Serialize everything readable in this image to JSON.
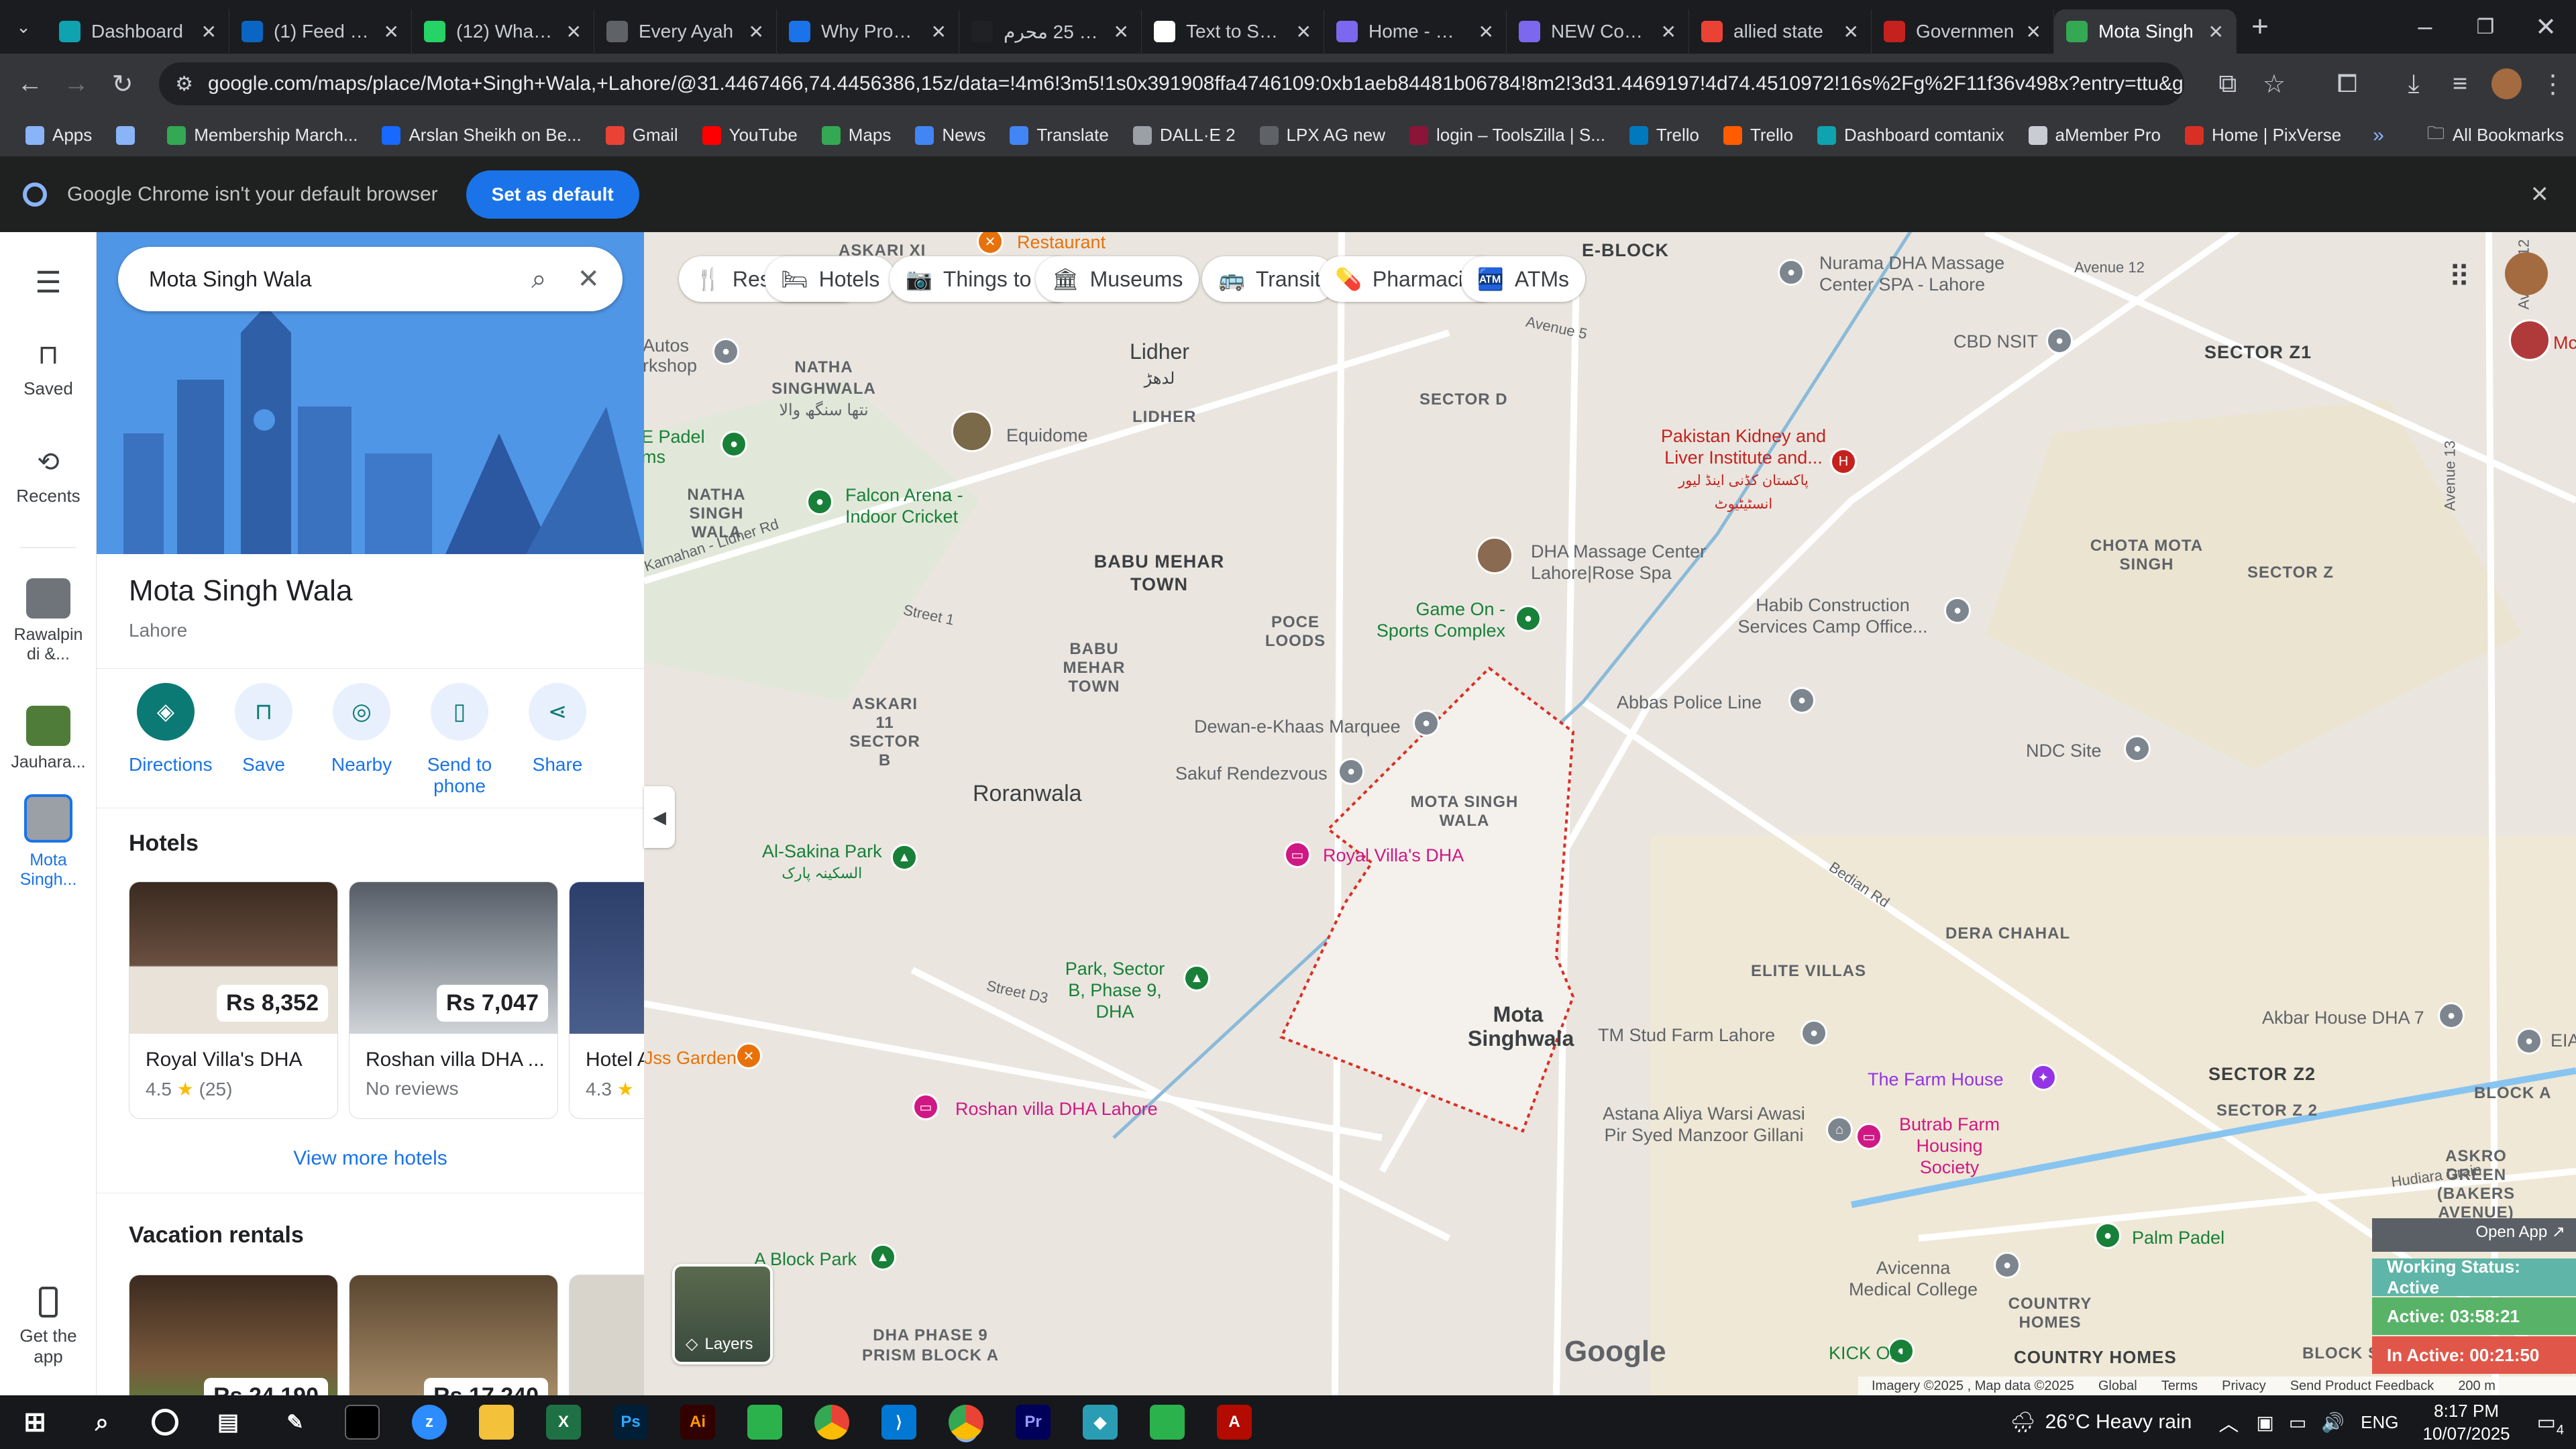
{
  "tabs": [
    {
      "title": "Dashboard",
      "color": "#0fa3b1"
    },
    {
      "title": "(1) Feed | Lin",
      "color": "#0a66c2"
    },
    {
      "title": "(12) WhatsAp",
      "color": "#25d366"
    },
    {
      "title": "Every Ayah",
      "color": "#5f6368"
    },
    {
      "title": "Why Progres",
      "color": "#1a73e8"
    },
    {
      "title": "دعاء 25 محرم",
      "color": "#202124"
    },
    {
      "title": "Text to Spee",
      "color": "#ffffff"
    },
    {
      "title": "Home - Can",
      "color": "#7b68ee"
    },
    {
      "title": "NEW Contra",
      "color": "#7b68ee"
    },
    {
      "title": "allied state",
      "color": "#ea4335"
    },
    {
      "title": "Governmen",
      "color": "#c5221f"
    },
    {
      "title": "Mota Singh",
      "color": "#34a853"
    }
  ],
  "address": {
    "url": "google.com/maps/place/Mota+Singh+Wala,+Lahore/@31.4467466,74.4456386,15z/data=!4m6!3m5!1s0x391908ffa4746109:0xb1aeb84481b06784!8m2!3d31.4469197!4d74.4510972!16s%2Fg%2F11f36v498x?entry=ttu&g_ep=EgoyMDI1M..."
  },
  "bookmarks": [
    {
      "label": "Apps",
      "color": "#8ab4f8"
    },
    {
      "label": "",
      "color": "#8ab4f8"
    },
    {
      "label": "Membership March...",
      "color": "#34a853"
    },
    {
      "label": "Arslan Sheikh on Be...",
      "color": "#1769ff"
    },
    {
      "label": "Gmail",
      "color": "#ea4335"
    },
    {
      "label": "YouTube",
      "color": "#ff0000"
    },
    {
      "label": "Maps",
      "color": "#34a853"
    },
    {
      "label": "News",
      "color": "#4285f4"
    },
    {
      "label": "Translate",
      "color": "#4285f4"
    },
    {
      "label": "DALL·E 2",
      "color": "#9aa0a6"
    },
    {
      "label": "LPX AG new",
      "color": "#5f6368"
    },
    {
      "label": "login – ToolsZilla | S...",
      "color": "#8b1538"
    },
    {
      "label": "Trello",
      "color": "#0079bf"
    },
    {
      "label": "Trello",
      "color": "#ff5c00"
    },
    {
      "label": "Dashboard comtanix",
      "color": "#0fa3b1"
    },
    {
      "label": "aMember Pro",
      "color": "#c9cdd3"
    },
    {
      "label": "Home | PixVerse",
      "color": "#d93025"
    }
  ],
  "all_bookmarks": "All Bookmarks",
  "infobar": {
    "message": "Google Chrome isn't your default browser",
    "button": "Set as default"
  },
  "rail": {
    "saved": "Saved",
    "recents": "Recents",
    "recent1": "Rawalpin di &...",
    "recent2": "Jauhara...",
    "recent3": "Mota Singh...",
    "get_app": "Get the app"
  },
  "panel": {
    "search_value": "Mota Singh Wala",
    "place_name": "Mota Singh Wala",
    "place_city": "Lahore",
    "actions": [
      "Directions",
      "Save",
      "Nearby",
      "Send to phone",
      "Share"
    ],
    "hotels_heading": "Hotels",
    "hotels": [
      {
        "name": "Royal Villa's DHA",
        "price": "Rs 8,352",
        "rating": "4.5",
        "reviews": "(25)"
      },
      {
        "name": "Roshan villa DHA ...",
        "price": "Rs 7,047",
        "rating": "",
        "reviews": "No reviews"
      },
      {
        "name": "Hotel A",
        "price": "",
        "rating": "4.3",
        "reviews": ""
      }
    ],
    "view_more_hotels": "View more hotels",
    "vacation_heading": "Vacation rentals",
    "vacation_prices": [
      "Rs 24,190",
      "Rs 17,240"
    ]
  },
  "map": {
    "categories": [
      "Restaurants",
      "Hotels",
      "Things to do",
      "Museums",
      "Transit",
      "Pharmacies",
      "ATMs"
    ],
    "area_labels": [
      {
        "text": "ASKARI XI"
      },
      {
        "text": "E-BLOCK"
      },
      {
        "text": "NATHA SINGHWALA"
      },
      {
        "text": "NATHA SINGH WALA"
      },
      {
        "text": "LIDHER"
      },
      {
        "text": "SECTOR D"
      },
      {
        "text": "BABU MEHAR TOWN"
      },
      {
        "text": "POCE LOODS"
      },
      {
        "text": "BABU MEHAR TOWN"
      },
      {
        "text": "ASKARI 11 SECTOR B"
      },
      {
        "text": "MOTA SINGH WALA"
      },
      {
        "text": "SECTOR Z1"
      },
      {
        "text": "CHOTA MOTA SINGH"
      },
      {
        "text": "SECTOR Z"
      },
      {
        "text": "DERA CHAHAL"
      },
      {
        "text": "ELITE VILLAS"
      },
      {
        "text": "SECTOR Z2"
      },
      {
        "text": "SECTOR Z 2"
      },
      {
        "text": "ASKRO GREEN (BAKERS AVENUE)"
      },
      {
        "text": "COUNTRY HOMES"
      },
      {
        "text": "DHA PHASE 9 PRISM BLOCK A"
      },
      {
        "text": "BLOCK A"
      },
      {
        "text": "BLOCK SE"
      },
      {
        "text": "COUNTRY HOMES"
      }
    ],
    "big_labels": [
      "Lidher",
      "Roranwala",
      "Mota Singhwala"
    ],
    "poi": [
      {
        "text": "Restaurant",
        "color": "#e8710a"
      },
      {
        "text": "Equidome",
        "color": "#5f6368"
      },
      {
        "text": "Falcon Arena - Indoor Cricket",
        "color": "#188038"
      },
      {
        "text": "E Padel ms",
        "color": "#188038"
      },
      {
        "text": "Autos rkshop",
        "color": "#5f6368"
      },
      {
        "text": "DHA Massage Center Lahore|Rose Spa",
        "color": "#5f6368"
      },
      {
        "text": "Game On - Sports Complex",
        "color": "#188038"
      },
      {
        "text": "Dewan-e-Khaas Marquee",
        "color": "#5f6368"
      },
      {
        "text": "Sakuf Rendezvous",
        "color": "#5f6368"
      },
      {
        "text": "Royal Villa's DHA",
        "color": "#d01884"
      },
      {
        "text": "Al-Sakina Park",
        "color": "#188038"
      },
      {
        "text": "Park, Sector B, Phase 9, DHA",
        "color": "#188038"
      },
      {
        "text": "Roshan villa DHA Lahore",
        "color": "#d01884"
      },
      {
        "text": "Jss Garden",
        "color": "#e8710a"
      },
      {
        "text": "A Block Park",
        "color": "#188038"
      },
      {
        "text": "Nurama DHA Massage Center SPA - Lahore",
        "color": "#5f6368"
      },
      {
        "text": "CBD NSIT",
        "color": "#5f6368"
      },
      {
        "text": "Pakistan Kidney and Liver Institute and...",
        "color": "#c5221f"
      },
      {
        "text": "Habib Construction Services Camp Office...",
        "color": "#5f6368"
      },
      {
        "text": "Abbas Police Line",
        "color": "#5f6368"
      },
      {
        "text": "NDC Site",
        "color": "#5f6368"
      },
      {
        "text": "TM Stud Farm Lahore",
        "color": "#5f6368"
      },
      {
        "text": "The Farm House",
        "color": "#9334e6"
      },
      {
        "text": "Astana Aliya Warsi Awasi Pir Syed Manzoor Gillani",
        "color": "#5f6368"
      },
      {
        "text": "Butrab Farm Housing Society",
        "color": "#d01884"
      },
      {
        "text": "Akbar House DHA 7",
        "color": "#5f6368"
      },
      {
        "text": "Palm Padel",
        "color": "#188038"
      },
      {
        "text": "Avicenna Medical College",
        "color": "#5f6368"
      },
      {
        "text": "KICK OFF",
        "color": "#188038"
      },
      {
        "text": "EIA",
        "color": "#5f6368"
      },
      {
        "text": "Mc",
        "color": "#c5221f"
      }
    ],
    "roads": [
      "Avenue 5",
      "Avenue 12",
      "Avenue 12",
      "Avenue 13",
      "Kamahan - Lidher Rd",
      "Street 1",
      "Street D3",
      "Bedian Rd",
      "Hudiara Drain"
    ],
    "urdu": [
      "نتھا سنگھ والا",
      "لدھڑ",
      "السکینہ پارک",
      "پاکستان کڈنی اینڈ لیور انسٹیٹیوٹ"
    ],
    "layers": "Layers",
    "footer": [
      "Imagery ©2025 , Map data ©2025",
      "Global",
      "Terms",
      "Privacy",
      "Send Product Feedback",
      "200 m"
    ],
    "google": "Google"
  },
  "tracker": {
    "open_app": "Open App ↗",
    "status": "Working Status: Active",
    "active": "Active: 03:58:21",
    "inactive": "In Active: 00:21:50"
  },
  "taskbar": {
    "weather": "26°C  Heavy rain",
    "lang": "ENG",
    "time": "8:17 PM",
    "date": "10/07/2025",
    "notif": "4"
  }
}
